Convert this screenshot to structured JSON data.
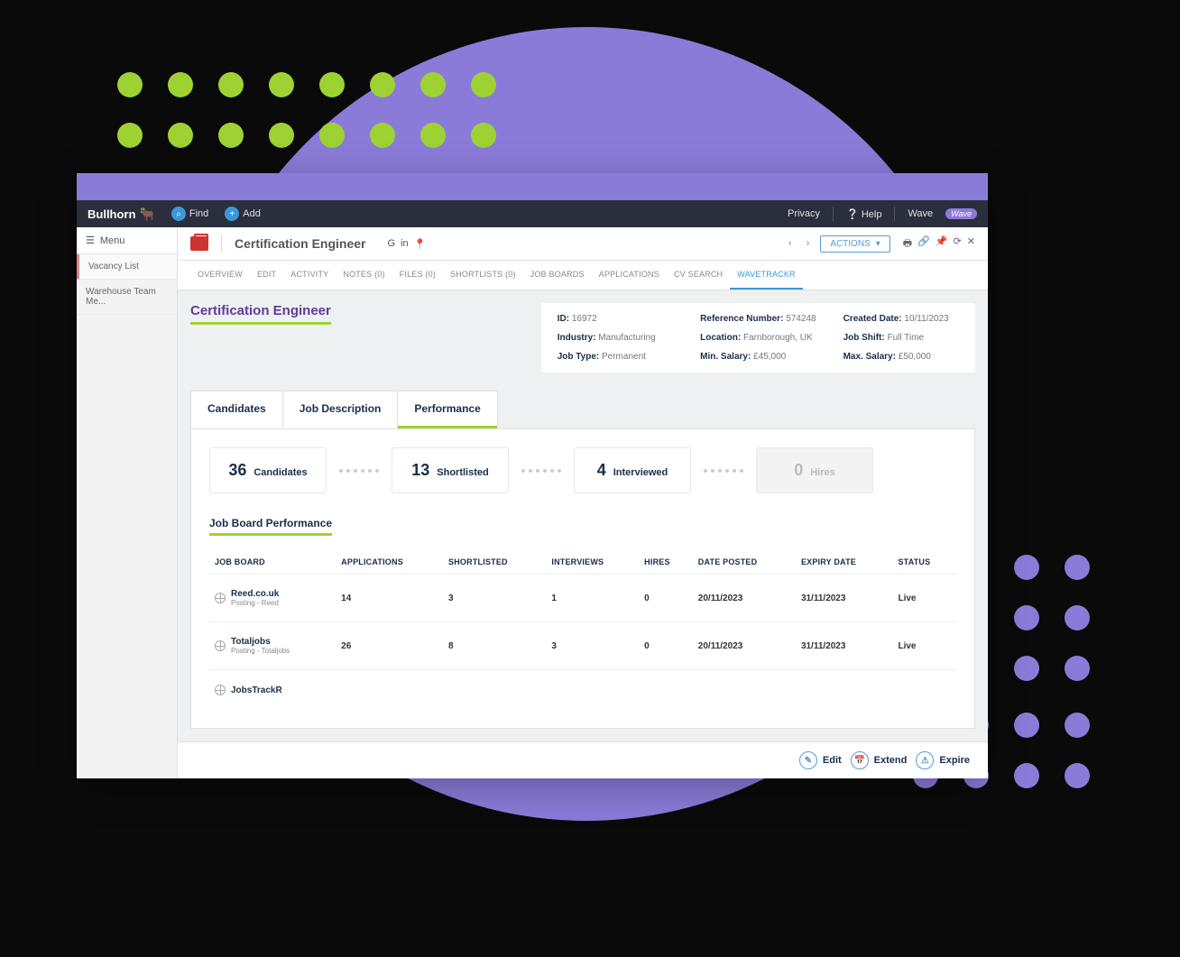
{
  "topbar": {
    "brand": "Bullhorn",
    "find": "Find",
    "add": "Add",
    "privacy": "Privacy",
    "help": "Help",
    "wave": "Wave",
    "wave_badge": "Wave"
  },
  "sidebar": {
    "menu": "Menu",
    "items": [
      "Vacancy List",
      "Warehouse Team Me..."
    ]
  },
  "header": {
    "title": "Certification Engineer",
    "actions": "ACTIONS"
  },
  "tabs": {
    "items": [
      "OVERVIEW",
      "EDIT",
      "ACTIVITY",
      "NOTES (0)",
      "FILES (0)",
      "SHORTLISTS (0)",
      "JOB BOARDS",
      "APPLICATIONS",
      "CV SEARCH",
      "WAVETRACKR"
    ],
    "active": 9
  },
  "job": {
    "title": "Certification Engineer",
    "meta": {
      "id_lab": "ID:",
      "id": "16972",
      "ref_lab": "Reference Number:",
      "ref": "574248",
      "created_lab": "Created Date:",
      "created": "10/11/2023",
      "industry_lab": "Industry:",
      "industry": "Manufacturing",
      "location_lab": "Location:",
      "location": "Farnborough, UK",
      "shift_lab": "Job Shift:",
      "shift": "Full Time",
      "type_lab": "Job Type:",
      "type": "Permanent",
      "min_lab": "Min. Salary:",
      "min": "£45,000",
      "max_lab": "Max. Salary:",
      "max": "£50,000"
    }
  },
  "inner_tabs": {
    "items": [
      "Candidates",
      "Job Description",
      "Performance"
    ],
    "active": 2
  },
  "stats": [
    {
      "num": "36",
      "label": "Candidates",
      "dim": false
    },
    {
      "num": "13",
      "label": "Shortlisted",
      "dim": false
    },
    {
      "num": "4",
      "label": "Interviewed",
      "dim": false
    },
    {
      "num": "0",
      "label": "Hires",
      "dim": true
    }
  ],
  "table": {
    "title": "Job Board Performance",
    "headers": [
      "JOB BOARD",
      "APPLICATIONS",
      "SHORTLISTED",
      "INTERVIEWS",
      "HIRES",
      "DATE POSTED",
      "EXPIRY DATE",
      "STATUS"
    ],
    "rows": [
      {
        "name": "Reed.co.uk",
        "sub": "Posting - Reed",
        "apps": "14",
        "short": "3",
        "int": "1",
        "hires": "0",
        "posted": "20/11/2023",
        "expiry": "31/11/2023",
        "status": "Live"
      },
      {
        "name": "Totaljobs",
        "sub": "Posting - Totaljobs",
        "apps": "26",
        "short": "8",
        "int": "3",
        "hires": "0",
        "posted": "20/11/2023",
        "expiry": "31/11/2023",
        "status": "Live"
      },
      {
        "name": "JobsTrackR",
        "sub": "",
        "apps": "",
        "short": "",
        "int": "",
        "hires": "",
        "posted": "",
        "expiry": "",
        "status": ""
      }
    ]
  },
  "footer": {
    "edit": "Edit",
    "extend": "Extend",
    "expire": "Expire"
  }
}
